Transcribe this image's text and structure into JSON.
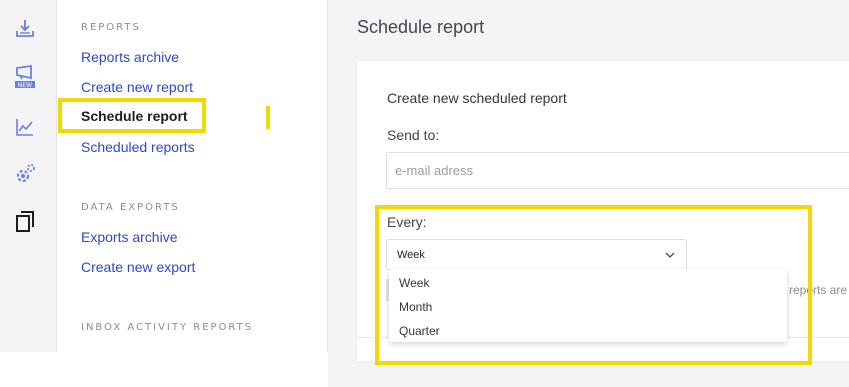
{
  "rail": {
    "icons": [
      "download-tray-icon",
      "new-campaign-icon",
      "analytics-line-icon",
      "settings-gear-icon",
      "copy-documents-icon"
    ],
    "badge_text": "NEW",
    "accent": "#6a7fe0"
  },
  "subnav": {
    "reports_label": "REPORTS",
    "items_reports": [
      "Reports archive",
      "Create new report",
      "Schedule report",
      "Scheduled reports"
    ],
    "data_exports_label": "DATA EXPORTS",
    "items_exports": [
      "Exports archive",
      "Create new export"
    ],
    "inbox_label": "INBOX ACTIVITY REPORTS"
  },
  "main": {
    "title": "Schedule report",
    "card_title": "Create new scheduled report",
    "send_to_label": "Send to:",
    "email_placeholder": "e-mail adress",
    "every_label": "Every:",
    "every_selected": "Week",
    "every_options": [
      "Week",
      "Month",
      "Quarter"
    ],
    "hint_fragment": "reports are"
  },
  "colors": {
    "highlight": "#f5d800",
    "link": "#2f48c8",
    "background": "#f4f4f6"
  }
}
